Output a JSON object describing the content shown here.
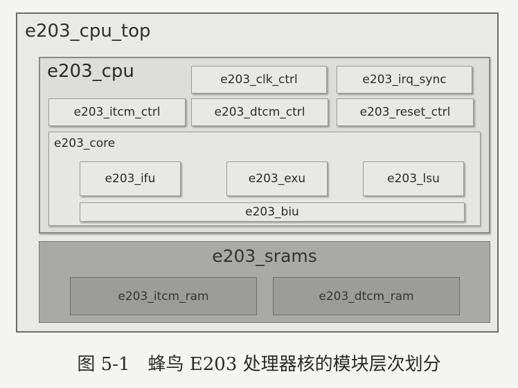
{
  "diagram": {
    "top_module": "e203_cpu_top",
    "cpu": {
      "title": "e203_cpu",
      "clk_ctrl": "e203_clk_ctrl",
      "irq_sync": "e203_irq_sync",
      "itcm_ctrl": "e203_itcm_ctrl",
      "dtcm_ctrl": "e203_dtcm_ctrl",
      "reset_ctrl": "e203_reset_ctrl",
      "core": {
        "title": "e203_core",
        "ifu": "e203_ifu",
        "exu": "e203_exu",
        "lsu": "e203_lsu",
        "biu": "e203_biu"
      }
    },
    "srams": {
      "title": "e203_srams",
      "itcm_ram": "e203_itcm_ram",
      "dtcm_ram": "e203_dtcm_ram"
    }
  },
  "caption": "图 5-1　蜂鸟 E203 处理器核的模块层次划分"
}
